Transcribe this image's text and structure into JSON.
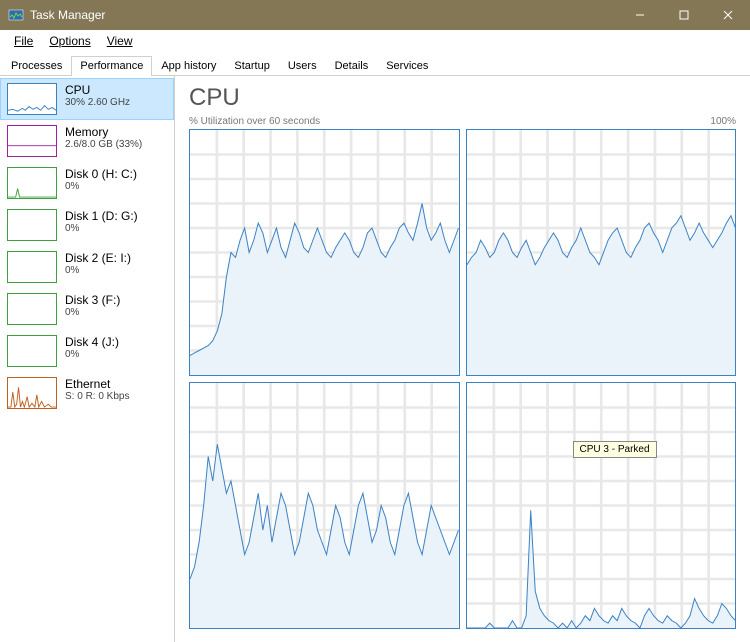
{
  "window": {
    "title": "Task Manager"
  },
  "menu": {
    "file": "File",
    "options": "Options",
    "view": "View"
  },
  "tabs": {
    "processes": "Processes",
    "performance": "Performance",
    "app_history": "App history",
    "startup": "Startup",
    "users": "Users",
    "details": "Details",
    "services": "Services"
  },
  "sidebar": {
    "cpu": {
      "label": "CPU",
      "sub": "30% 2.60 GHz"
    },
    "memory": {
      "label": "Memory",
      "sub": "2.6/8.0 GB (33%)"
    },
    "disk0": {
      "label": "Disk 0 (H: C:)",
      "sub": "0%"
    },
    "disk1": {
      "label": "Disk 1 (D: G:)",
      "sub": "0%"
    },
    "disk2": {
      "label": "Disk 2 (E: I:)",
      "sub": "0%"
    },
    "disk3": {
      "label": "Disk 3 (F:)",
      "sub": "0%"
    },
    "disk4": {
      "label": "Disk 4 (J:)",
      "sub": "0%"
    },
    "ethernet": {
      "label": "Ethernet",
      "sub": "S: 0 R: 0 Kbps"
    }
  },
  "main": {
    "title": "CPU",
    "axis_left": "% Utilization over 60 seconds",
    "axis_right": "100%",
    "tooltip": "CPU 3 - Parked"
  },
  "chart_data": [
    {
      "type": "area",
      "title": "CPU 0",
      "xlabel": "",
      "ylabel": "% Utilization",
      "ylim": [
        0,
        100
      ],
      "x_seconds": 60,
      "values": [
        8,
        9,
        10,
        11,
        12,
        14,
        18,
        25,
        40,
        50,
        48,
        55,
        60,
        50,
        55,
        62,
        58,
        50,
        55,
        60,
        52,
        48,
        55,
        62,
        58,
        52,
        50,
        55,
        60,
        55,
        50,
        48,
        52,
        55,
        58,
        55,
        50,
        48,
        52,
        58,
        60,
        55,
        50,
        48,
        52,
        55,
        60,
        62,
        58,
        55,
        62,
        70,
        60,
        55,
        58,
        62,
        55,
        50,
        55,
        60
      ]
    },
    {
      "type": "area",
      "title": "CPU 1",
      "xlabel": "",
      "ylabel": "% Utilization",
      "ylim": [
        0,
        100
      ],
      "x_seconds": 60,
      "values": [
        45,
        48,
        50,
        55,
        52,
        48,
        50,
        55,
        58,
        55,
        50,
        48,
        52,
        55,
        50,
        45,
        48,
        52,
        55,
        58,
        55,
        50,
        48,
        52,
        55,
        60,
        55,
        50,
        48,
        45,
        50,
        55,
        58,
        60,
        55,
        50,
        48,
        52,
        55,
        60,
        62,
        58,
        55,
        50,
        55,
        60,
        62,
        65,
        60,
        55,
        58,
        62,
        58,
        55,
        52,
        55,
        58,
        62,
        65,
        60
      ]
    },
    {
      "type": "area",
      "title": "CPU 2",
      "xlabel": "",
      "ylabel": "% Utilization",
      "ylim": [
        0,
        100
      ],
      "x_seconds": 60,
      "values": [
        20,
        25,
        35,
        50,
        70,
        60,
        75,
        65,
        55,
        60,
        50,
        40,
        30,
        35,
        45,
        55,
        40,
        50,
        35,
        45,
        55,
        50,
        40,
        30,
        35,
        45,
        55,
        50,
        40,
        35,
        30,
        40,
        50,
        45,
        35,
        30,
        40,
        50,
        55,
        45,
        35,
        40,
        50,
        45,
        35,
        30,
        40,
        50,
        55,
        45,
        35,
        30,
        40,
        50,
        45,
        40,
        35,
        30,
        35,
        40
      ]
    },
    {
      "type": "area",
      "title": "CPU 3 - Parked",
      "xlabel": "",
      "ylabel": "% Utilization",
      "ylim": [
        0,
        100
      ],
      "x_seconds": 60,
      "values": [
        0,
        0,
        0,
        0,
        0,
        2,
        0,
        0,
        0,
        0,
        3,
        0,
        0,
        5,
        48,
        15,
        8,
        5,
        3,
        2,
        0,
        2,
        0,
        3,
        0,
        2,
        5,
        3,
        8,
        5,
        3,
        2,
        5,
        3,
        8,
        5,
        3,
        2,
        0,
        5,
        8,
        5,
        3,
        2,
        5,
        3,
        2,
        0,
        2,
        5,
        12,
        8,
        5,
        3,
        2,
        5,
        10,
        8,
        5,
        3
      ]
    }
  ],
  "colors": {
    "cpu_stroke": "#3b82c4",
    "cpu_fill": "#eaf2fa",
    "memory": "#a020a0",
    "disk": "#3fa040",
    "ethernet": "#c06020"
  }
}
